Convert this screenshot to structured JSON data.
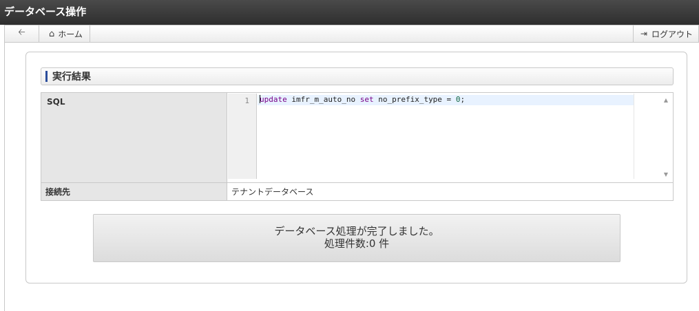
{
  "header": {
    "title": "データベース操作"
  },
  "nav": {
    "back_icon": "arrow-left-icon",
    "home_label": "ホーム",
    "logout_label": "ログアウト"
  },
  "section": {
    "title": "実行結果"
  },
  "table": {
    "sql_label": "SQL",
    "line_number": "1",
    "code": {
      "kw_update": "update",
      "mid": " imfr_m_auto_no ",
      "kw_set": "set",
      "tail": " no_prefix_type = ",
      "value": "0",
      "end": ";"
    },
    "conn_label": "接続先",
    "conn_value": "テナントデータベース"
  },
  "message": {
    "line1": "データベース処理が完了しました。",
    "line2": "処理件数:0 件"
  },
  "colors": {
    "accent": "#2a4d9c",
    "titlebar": "#3a3a3a"
  }
}
